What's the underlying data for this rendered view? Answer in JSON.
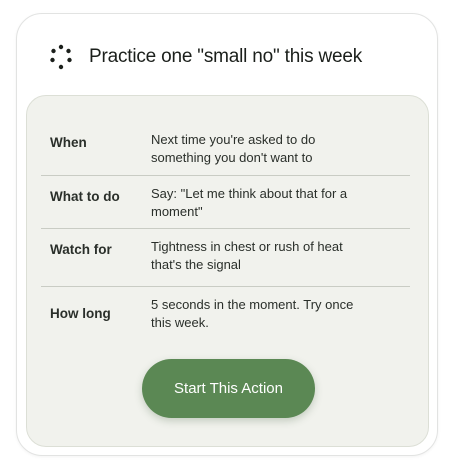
{
  "header": {
    "icon": "loading-dots-icon",
    "title": "Practice one \"small no\" this week"
  },
  "details": [
    {
      "label": "When",
      "value": "Next time you're asked to do something you don't want to"
    },
    {
      "label": "What to do",
      "value": "Say: \"Let me think about that for a moment\""
    },
    {
      "label": "Watch for",
      "value": "Tightness in chest or rush of heat that's the signal"
    },
    {
      "label": "How long",
      "value": "5 seconds in the moment. Try once this week."
    }
  ],
  "action": {
    "label": "Start This Action"
  },
  "colors": {
    "accent": "#5b8854",
    "panel_background": "#f1f2ed",
    "divider": "#c9ccc4"
  }
}
